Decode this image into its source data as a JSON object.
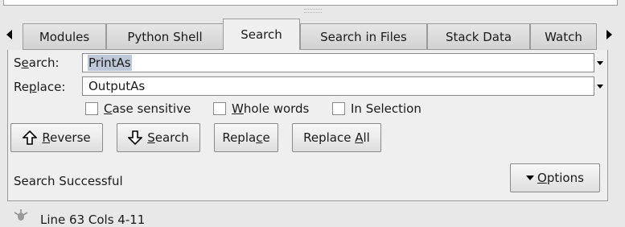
{
  "tabs": [
    {
      "label": "Modules"
    },
    {
      "label": "Python Shell"
    },
    {
      "label": "Search"
    },
    {
      "label": "Search in Files"
    },
    {
      "label": "Stack Data"
    },
    {
      "label": "Watch"
    }
  ],
  "active_tab": "Search",
  "search": {
    "label_pre": "S",
    "label_mn": "e",
    "label_post": "arch:",
    "value": "PrintAs"
  },
  "replace": {
    "label_pre": "Re",
    "label_mn": "p",
    "label_post": "lace:",
    "value": "OutputAs"
  },
  "options": {
    "case_sensitive": {
      "mn": "C",
      "rest": "ase sensitive",
      "checked": false
    },
    "whole_words": {
      "mn": "W",
      "rest": "hole words",
      "checked": false
    },
    "in_selection": {
      "label": "In Selection",
      "checked": false
    }
  },
  "buttons": {
    "reverse": {
      "mn": "R",
      "rest": "everse"
    },
    "search": {
      "mn": "S",
      "rest": "earch"
    },
    "replace": {
      "pre": "Repla",
      "mn": "c",
      "post": "e"
    },
    "replace_all": {
      "pre": "Replace ",
      "mn": "A",
      "post": "ll"
    },
    "options": {
      "mn": "O",
      "rest": "ptions"
    }
  },
  "status": "Search Successful",
  "bottom_status": "Line 63 Cols 4-11"
}
